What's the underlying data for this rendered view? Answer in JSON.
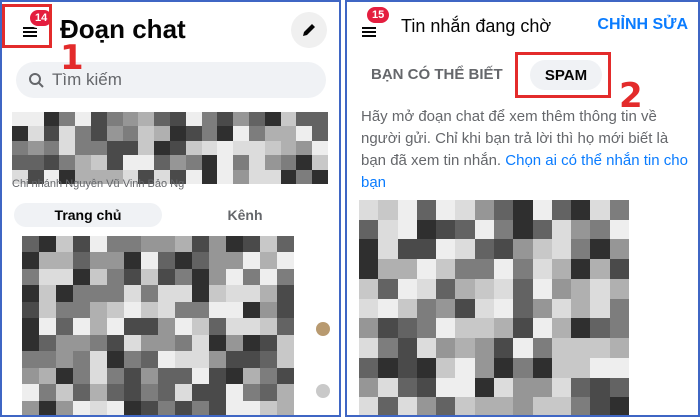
{
  "left": {
    "menu_badge": "14",
    "title": "Đoạn chat",
    "search_placeholder": "Tìm kiếm",
    "story_names": "Chi nhánh   Nguyễn    Vũ    Vinh   Bảo Ng",
    "tabs": {
      "home": "Trang chủ",
      "channel": "Kênh"
    },
    "step_label": "1"
  },
  "right": {
    "menu_badge": "15",
    "title": "Tin nhắn đang chờ",
    "edit_label": "CHỈNH SỬA",
    "tab_known": "BẠN CÓ THỂ BIẾT",
    "tab_spam": "SPAM",
    "info_text": "Hãy mở đoạn chat để xem thêm thông tin về người gửi. Chỉ khi bạn trả lời thì họ mới biết là bạn đã xem tin nhắn.",
    "info_link": "Chọn ai có thể nhắn tin cho bạn",
    "step_label": "2"
  },
  "colors": {
    "accent": "#0a7cff",
    "annotation_red": "#e32b2b",
    "badge_red": "#e41e3f",
    "frame_blue": "#3f66c4"
  },
  "icons": {
    "menu": "hamburger-icon",
    "compose": "pen-icon",
    "search": "search-icon"
  }
}
